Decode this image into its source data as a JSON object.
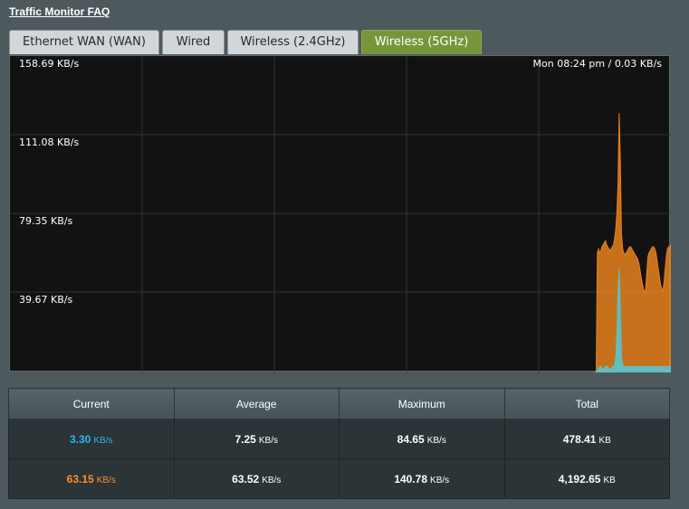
{
  "header": {
    "faq_link": "Traffic Monitor FAQ"
  },
  "tabs": [
    {
      "label": "Ethernet WAN (WAN)",
      "active": false
    },
    {
      "label": "Wired",
      "active": false
    },
    {
      "label": "Wireless (2.4GHz)",
      "active": false
    },
    {
      "label": "Wireless (5GHz)",
      "active": true
    }
  ],
  "graph": {
    "y_labels": [
      "158.69 KB/s",
      "111.08 KB/s",
      "79.35 KB/s",
      "39.67 KB/s"
    ],
    "time_readout": "Mon 08:24 pm / 0.03 KB/s",
    "colors": {
      "tx": "#e8821e",
      "rx": "#5fc0c6"
    }
  },
  "chart_data": {
    "type": "area",
    "ylim": [
      0,
      158.69
    ],
    "series": [
      {
        "color": "#e8821e",
        "values": [
          0,
          0,
          0,
          60,
          62,
          60,
          61,
          63,
          64,
          65,
          66,
          64,
          63,
          62,
          61,
          62,
          63,
          64,
          67,
          72,
          80,
          95,
          130,
          105,
          70,
          62,
          60,
          59,
          60,
          61,
          62,
          63,
          63,
          62,
          61,
          60,
          59,
          58,
          57,
          55,
          52,
          48,
          45,
          42,
          40,
          42,
          50,
          58,
          60,
          61,
          62,
          63,
          63,
          62,
          60,
          56,
          52,
          48,
          44,
          42,
          41,
          45,
          52,
          58,
          62,
          63,
          63,
          64
        ]
      },
      {
        "color": "#5fc0c6",
        "values": [
          0,
          0,
          0,
          1,
          2,
          3,
          3,
          2,
          2,
          2,
          3,
          3,
          3,
          2,
          2,
          2,
          3,
          3,
          4,
          8,
          20,
          40,
          52,
          30,
          8,
          4,
          3,
          3,
          3,
          3,
          3,
          3,
          3,
          3,
          3,
          3,
          3,
          3,
          3,
          3,
          3,
          3,
          3,
          3,
          3,
          3,
          3,
          3,
          3,
          3,
          3,
          3,
          3,
          3,
          3,
          3,
          3,
          3,
          3,
          3,
          3,
          3,
          3,
          3,
          3,
          3,
          3,
          3
        ]
      }
    ]
  },
  "stats": {
    "headers": [
      "Current",
      "Average",
      "Maximum",
      "Total"
    ],
    "rows": [
      [
        {
          "value": "3.30",
          "unit": "KB/s"
        },
        {
          "value": "7.25",
          "unit": "KB/s"
        },
        {
          "value": "84.65",
          "unit": "KB/s"
        },
        {
          "value": "478.41",
          "unit": "KB"
        }
      ],
      [
        {
          "value": "63.15",
          "unit": "KB/s"
        },
        {
          "value": "63.52",
          "unit": "KB/s"
        },
        {
          "value": "140.78",
          "unit": "KB/s"
        },
        {
          "value": "4,192.65",
          "unit": "KB"
        }
      ]
    ]
  }
}
